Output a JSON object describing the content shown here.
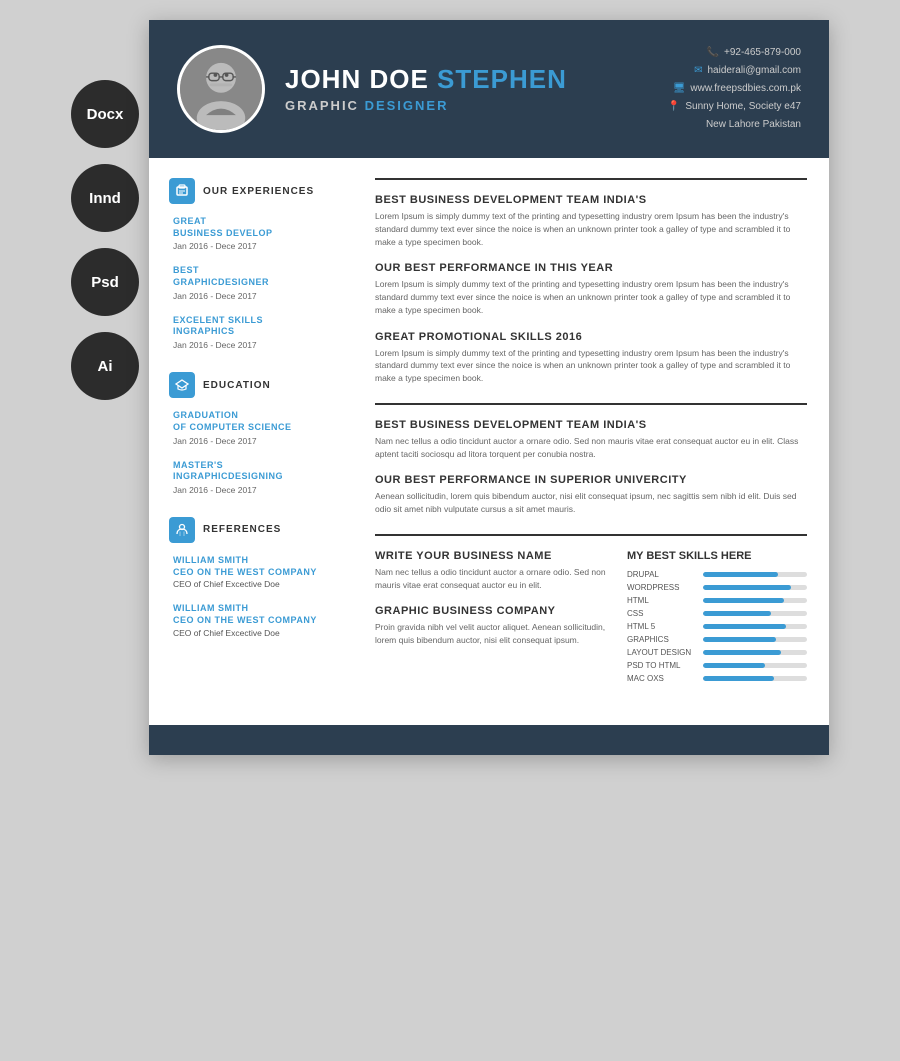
{
  "format_badges": [
    "Docx",
    "Innd",
    "Psd",
    "Ai"
  ],
  "header": {
    "name_first": "JOHN DOE",
    "name_last": "STEPHEN",
    "subtitle_main": "GRAPHIC",
    "subtitle_accent": "DESIGNER",
    "phone": "+92-465-879-000",
    "email": "haiderali@gmail.com",
    "website": "www.freepsdbies.com.pk",
    "address1": "Sunny Home, Society e47",
    "address2": "New Lahore Pakistan"
  },
  "experience": {
    "section_title": "OUR EXPERIENCES",
    "entries": [
      {
        "title": "GREAT\nBUSINESS DEVELOP",
        "date": "Jan 2016 - Dece 2017"
      },
      {
        "title": "BEST\nGRAPHICDESIGNER",
        "date": "Jan 2016 - Dece 2017"
      },
      {
        "title": "EXCELENT SKILLS\nINGRAPHICS",
        "date": "Jan 2016 - Dece 2017"
      }
    ]
  },
  "education": {
    "section_title": "EDUCATION",
    "entries": [
      {
        "title": "GRADUATION\nOF COMPUTER SCIENCE",
        "date": "Jan 2016 - Dece 2017"
      },
      {
        "title": "MASTER'S\nINGRAPHICDESIGNING",
        "date": "Jan 2016 - Dece 2017"
      }
    ]
  },
  "references": {
    "section_title": "REFERENCES",
    "entries": [
      {
        "name": "WILLIAM SMITH",
        "company": "CEO ON THE WEST COMPANY",
        "role": "CEO of Chief Excective Doe"
      },
      {
        "name": "WILLIAM SMITH",
        "company": "CEO ON THE WEST COMPANY",
        "role": "CEO of Chief Excective Doe"
      }
    ]
  },
  "right_experience": {
    "entries": [
      {
        "title": "BEST BUSINESS DEVELOPMENT TEAM INDIA'S",
        "text": "Lorem Ipsum is simply dummy text of the printing and typesetting industry orem Ipsum has been the industry's standard dummy text ever since the noice is when an unknown printer took a galley of type and scrambled it to make a type specimen book."
      },
      {
        "title": "OUR BEST PERFORMANCE IN THIS YEAR",
        "text": "Lorem Ipsum is simply dummy text of the printing and typesetting industry orem Ipsum has been the industry's standard dummy text ever since the noice is when an unknown printer took a galley of type and scrambled it to make a type specimen book."
      },
      {
        "title": "GREAT PROMOTIONAL SKILLS 2016",
        "text": "Lorem Ipsum is simply dummy text of the printing and typesetting industry orem Ipsum has been the industry's standard dummy text ever since the noice is when an unknown printer took a galley of type and scrambled it to make a type specimen book."
      }
    ]
  },
  "right_education": {
    "entries": [
      {
        "title": "BEST BUSINESS DEVELOPMENT TEAM INDIA'S",
        "text": "Nam nec tellus a odio tincidunt auctor a ornare odio. Sed non mauris vitae erat consequat auctor eu in elit. Class aptent taciti sociosqu ad litora torquent per conubia nostra."
      },
      {
        "title": "OUR BEST PERFORMANCE IN SUPERIOR UNIVERCITY",
        "text": "Aenean sollicitudin, lorem quis bibendum auctor, nisi elit consequat ipsum, nec sagittis sem nibh id elit. Duis sed odio sit amet nibh vulputate cursus a sit amet mauris."
      }
    ]
  },
  "biz_entries": [
    {
      "title": "WRITE YOUR BUSINESS NAME",
      "text": "Nam nec tellus a odio tincidunt auctor a ornare odio. Sed non mauris vitae erat consequat auctor eu in elit."
    },
    {
      "title": "GRAPHIC BUSINESS COMPANY",
      "text": "Proin gravida nibh vel velit auctor aliquet. Aenean sollicitudin, lorem quis bibendum auctor, nisi elit consequat ipsum."
    }
  ],
  "skills": {
    "title": "MY BEST SKILLS HERE",
    "items": [
      {
        "label": "DRUPAL",
        "percent": 72
      },
      {
        "label": "WORDPRESS",
        "percent": 85
      },
      {
        "label": "HTML",
        "percent": 78
      },
      {
        "label": "CSS",
        "percent": 65
      },
      {
        "label": "HTML 5",
        "percent": 80
      },
      {
        "label": "GRAPHICS",
        "percent": 70
      },
      {
        "label": "LAYOUT DESIGN",
        "percent": 75
      },
      {
        "label": "PSD TO HTML",
        "percent": 60
      },
      {
        "label": "MAC OXS",
        "percent": 68
      }
    ]
  }
}
